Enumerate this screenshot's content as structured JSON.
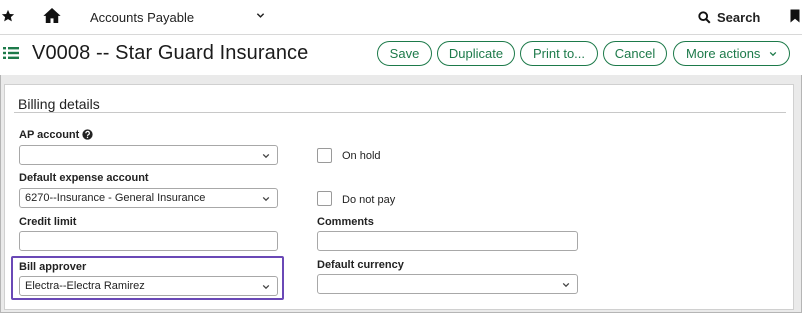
{
  "topbar": {
    "module": "Accounts Payable",
    "search_label": "Search"
  },
  "header": {
    "title": "V0008 -- Star Guard Insurance",
    "buttons": {
      "save": "Save",
      "duplicate": "Duplicate",
      "print": "Print to...",
      "cancel": "Cancel",
      "more": "More actions"
    }
  },
  "section": {
    "title": "Billing details"
  },
  "fields": {
    "ap_account": {
      "label": "AP account",
      "value": ""
    },
    "default_expense": {
      "label": "Default expense account",
      "value": "6270--Insurance - General Insurance"
    },
    "credit_limit": {
      "label": "Credit limit",
      "value": ""
    },
    "bill_approver": {
      "label": "Bill approver",
      "value": "Electra--Electra Ramirez"
    },
    "on_hold": {
      "label": "On hold",
      "checked": false
    },
    "do_not_pay": {
      "label": "Do not pay",
      "checked": false
    },
    "comments": {
      "label": "Comments",
      "value": ""
    },
    "default_currency": {
      "label": "Default currency",
      "value": ""
    }
  },
  "colors": {
    "accent": "#1d7a4a",
    "highlight": "#6a48b6"
  },
  "icons": [
    "star-icon",
    "home-icon",
    "chevron-down-icon",
    "search-icon",
    "bookmark-icon",
    "list-icon",
    "help-icon"
  ]
}
